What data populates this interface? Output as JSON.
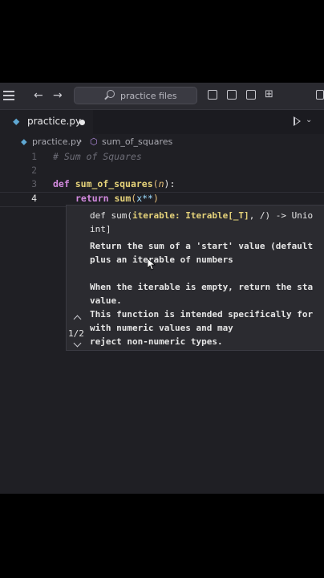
{
  "titlebar": {
    "search_placeholder": "practice files",
    "nav_back": "←",
    "nav_forward": "→"
  },
  "tab": {
    "filename": "practice.py",
    "modified": true
  },
  "breadcrumb": {
    "file": "practice.py",
    "separator": "›",
    "symbol": "sum_of_squares"
  },
  "editor": {
    "line_numbers": [
      "1",
      "2",
      "3",
      "4"
    ],
    "comment": "# Sum of Squares",
    "def_kw": "def",
    "func_name": "sum_of_squares",
    "open_paren": "(",
    "param": "n",
    "close_colon": "):",
    "return_kw": "return",
    "call_name": "sum",
    "call_paren": "(",
    "expr": "x**",
    "call_close": ")"
  },
  "signature_popup": {
    "sig_prefix": "def sum(",
    "sig_param": "iterable: Iterable[_T]",
    "sig_rest": ", /) -> Unio",
    "sig_line2": "int]",
    "doc_lines": [
      "Return the sum of a 'start' value (default",
      "plus an iterable of numbers",
      "",
      "When the iterable is empty, return the sta",
      "value.",
      "This function is intended specifically for",
      "with numeric values and may",
      "reject non-numeric types."
    ],
    "overload_counter": "1/2"
  },
  "colors": {
    "background": "#1f1f24",
    "keyword": "#d38adf",
    "function": "#e6d37a",
    "comment": "#6e6e78",
    "python_icon": "#5fa8d3"
  },
  "icons": [
    "menu-icon",
    "search-icon",
    "sidebar-icon",
    "panel-icon",
    "split-icon",
    "layout-icon",
    "python-icon",
    "symbol-icon",
    "run-icon",
    "chevron-down-icon"
  ]
}
